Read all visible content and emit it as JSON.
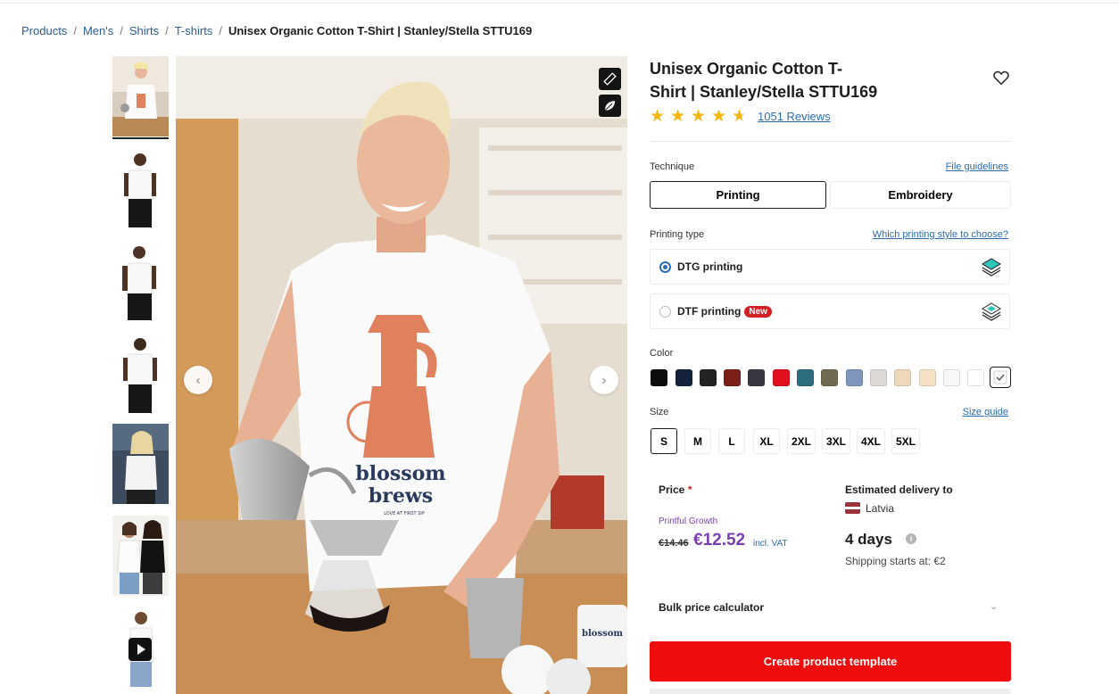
{
  "breadcrumb": {
    "items": [
      "Products",
      "Men's",
      "Shirts",
      "T-shirts"
    ],
    "current": "Unisex Organic Cotton T-Shirt | Stanley/Stella STTU169"
  },
  "product": {
    "title_line1": "Unisex Organic Cotton T-",
    "title_line2": "Shirt | Stanley/Stella STTU169",
    "rating": 4.5,
    "rating_max": 5,
    "reviews": "1051 Reviews"
  },
  "gallery": {
    "thumbnail_count": 7,
    "active_thumbnail": 1,
    "last_thumbnail_is_video": true,
    "main_image_text": {
      "brand_line1": "blossom",
      "brand_line2": "brews",
      "tagline": "LOVE AT FIRST SIP",
      "mug_text": "blossom"
    },
    "icons": [
      "ruler-icon",
      "leaf-icon",
      "chevron-left-icon",
      "chevron-right-icon"
    ]
  },
  "technique": {
    "label": "Technique",
    "guidelines_link": "File guidelines",
    "options": [
      "Printing",
      "Embroidery"
    ],
    "selected": "Printing"
  },
  "printing_type": {
    "label": "Printing type",
    "help_link": "Which printing style to choose?",
    "options": [
      {
        "label": "DTG printing",
        "selected": true,
        "badge": ""
      },
      {
        "label": "DTF printing",
        "selected": false,
        "badge": "New"
      }
    ]
  },
  "color": {
    "label": "Color",
    "swatches": [
      "#0c0c0c",
      "#13213a",
      "#232323",
      "#7a2019",
      "#383841",
      "#e0101f",
      "#2e6c80",
      "#6f6a52",
      "#7e96bd",
      "#dddad6",
      "#ecd9bc",
      "#f5e2c5",
      "#f7f7f7",
      "#ffffff",
      "#ffffff"
    ],
    "selected_index": 14
  },
  "size": {
    "label": "Size",
    "guide_link": "Size guide",
    "options": [
      "S",
      "M",
      "L",
      "XL",
      "2XL",
      "3XL",
      "4XL",
      "5XL"
    ],
    "selected": "S"
  },
  "price": {
    "label": "Price",
    "required_mark": "*",
    "plan": "Printful Growth",
    "old": "€14.46",
    "current": "€12.52",
    "vat_note": "incl. VAT"
  },
  "delivery": {
    "label": "Estimated delivery to",
    "country": "Latvia",
    "days": "4 days",
    "info": "i",
    "shipping": "Shipping starts at: €2"
  },
  "bulk": {
    "label": "Bulk price calculator"
  },
  "cta": {
    "label": "Create product template"
  },
  "colors": {
    "link": "#2b6cb0",
    "accent_red": "#ee0c0c",
    "price_purple": "#7b3fb5",
    "star": "#f3b712"
  }
}
